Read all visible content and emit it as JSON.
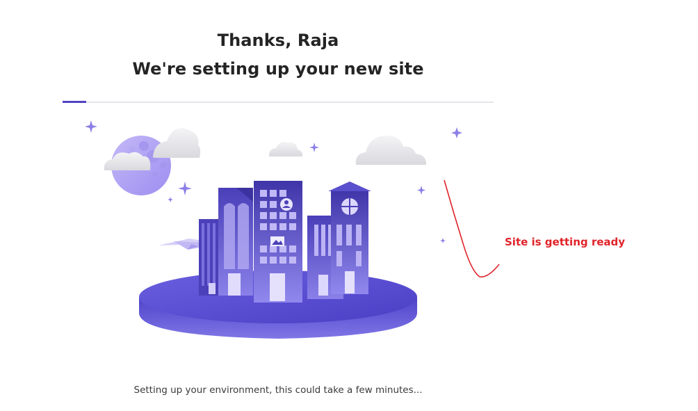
{
  "header": {
    "greeting": "Thanks, Raja",
    "subtitle": "We're setting up your new site"
  },
  "progress": {
    "fraction": 0.055
  },
  "illustration": {
    "icon": "city-on-platform-illustration",
    "accent_color": "#5b4fd1"
  },
  "annotation": {
    "text": "Site is getting ready",
    "color": "#e0232a"
  },
  "status": {
    "message": "Setting up your environment, this could take a few minutes..."
  }
}
